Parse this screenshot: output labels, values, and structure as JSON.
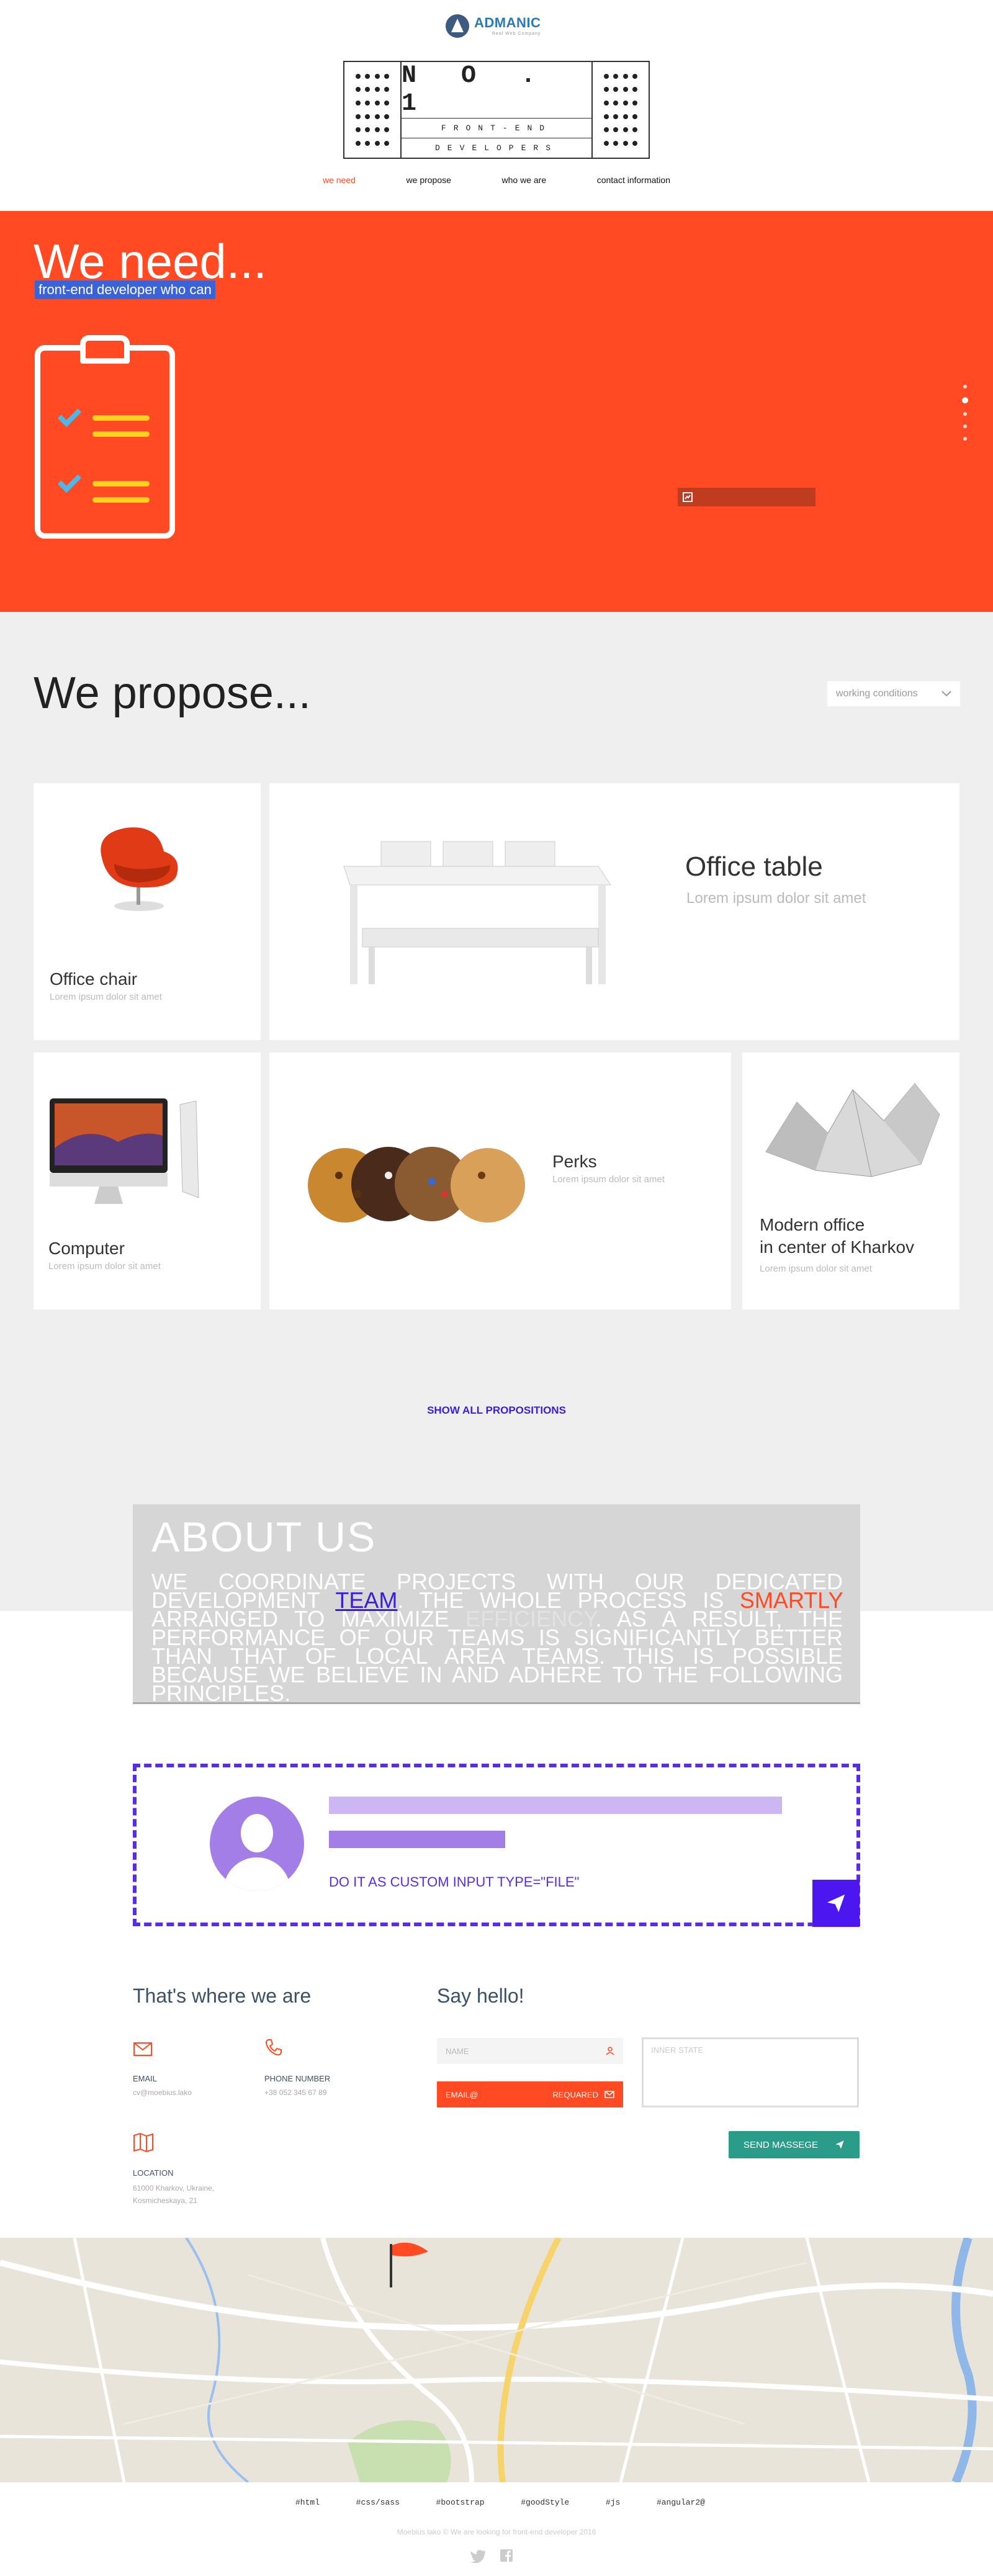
{
  "header": {
    "logo_text": "ADMANIC",
    "logo_sub": "Real Web Company",
    "badge_line1": "N O . 1",
    "badge_line2": "FRONT-END",
    "badge_line3": "DEVELOPERS"
  },
  "nav": [
    {
      "label": "we need"
    },
    {
      "label": "we propose"
    },
    {
      "label": "who we are"
    },
    {
      "label": "contact information"
    }
  ],
  "hero": {
    "title": "We need...",
    "subtitle": "front-end developer who can"
  },
  "propose": {
    "title": "We propose...",
    "dropdown": "working conditions",
    "show_all": "SHOW ALL PROPOSITIONS",
    "cards": [
      {
        "title": "Office chair",
        "sub": "Lorem ipsum dolor sit amet"
      },
      {
        "title": "Office table",
        "sub": "Lorem ipsum dolor sit amet"
      },
      {
        "title": "Computer",
        "sub": "Lorem ipsum dolor sit amet"
      },
      {
        "title": "Perks",
        "sub": "Lorem ipsum dolor sit amet"
      },
      {
        "title": "Modern office",
        "title2": "in center of Kharkov",
        "sub": "Lorem ipsum dolor sit amet"
      }
    ]
  },
  "about": {
    "title": "ABOUT US",
    "text_a": "We coordinate projects with our dedicated development",
    "team": "team",
    "text_b": ". The whole process is",
    "smartly": "smartly",
    "text_c": "arranged to maximize",
    "efficiency": "efficiency",
    "text_d": ". As a result, the performance of our teams is significantly better than that of local area teams. This is possible because we believe in and adhere to the following principles."
  },
  "upload": {
    "label": "do it as custom input type=\"file\""
  },
  "contact": {
    "where_title": "That's where we are",
    "email_label": "EMAIL",
    "email_value": "cv@moebius.lako",
    "phone_label": "PHONE NUMBER",
    "phone_value": "+38 052 345 67 89",
    "location_label": "LOCATION",
    "location_line1": "61000 Kharkov, Ukraine,",
    "location_line2": "Kosmicheskaya, 21",
    "hello_title": "Say hello!",
    "name_placeholder": "NAME",
    "email_placeholder": "EMAIL@",
    "email_required": "REQUARED",
    "textarea_placeholder": "INNER STATE",
    "send_label": "SEND MASSEGE"
  },
  "footer": {
    "tags": [
      "#html",
      "#css/sass",
      "#bootstrap",
      "#goodStyle",
      "#js",
      "#angular2@"
    ],
    "copyright": "Moebius lako © We are looking for front-end developer 2016"
  },
  "colors": {
    "accent": "#ff4a23",
    "purple": "#5a2ee0",
    "teal": "#2b9b8a"
  }
}
